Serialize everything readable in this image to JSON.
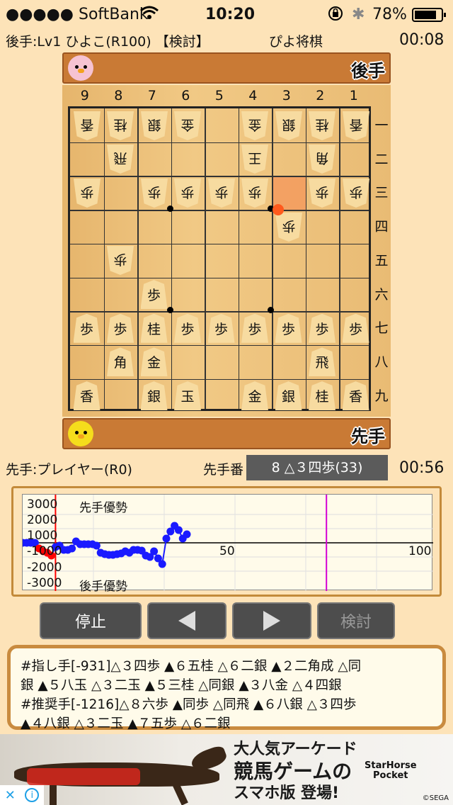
{
  "status_bar": {
    "carrier": "●●●●● SoftBank",
    "time": "10:20",
    "battery": "78%"
  },
  "header": {
    "gote_player": "後手:Lv1 ひよこ(R100) 【検討】",
    "app_title": "ぴよ将棋",
    "gote_time": "00:08"
  },
  "gote_hand": {
    "label": "後手"
  },
  "sente_hand": {
    "label": "先手"
  },
  "board": {
    "col_labels": [
      "9",
      "8",
      "7",
      "6",
      "5",
      "4",
      "3",
      "2",
      "1"
    ],
    "row_labels": [
      "一",
      "二",
      "三",
      "四",
      "五",
      "六",
      "七",
      "八",
      "九"
    ],
    "last_move_to": {
      "col": 3,
      "row": 4
    },
    "highlight_from": {
      "col": 3,
      "row": 3
    },
    "pieces": [
      {
        "col": 9,
        "row": 1,
        "p": "香",
        "o": "g"
      },
      {
        "col": 8,
        "row": 1,
        "p": "桂",
        "o": "g"
      },
      {
        "col": 7,
        "row": 1,
        "p": "銀",
        "o": "g"
      },
      {
        "col": 6,
        "row": 1,
        "p": "金",
        "o": "g"
      },
      {
        "col": 4,
        "row": 1,
        "p": "金",
        "o": "g"
      },
      {
        "col": 3,
        "row": 1,
        "p": "銀",
        "o": "g"
      },
      {
        "col": 2,
        "row": 1,
        "p": "桂",
        "o": "g"
      },
      {
        "col": 1,
        "row": 1,
        "p": "香",
        "o": "g"
      },
      {
        "col": 8,
        "row": 2,
        "p": "飛",
        "o": "g"
      },
      {
        "col": 4,
        "row": 2,
        "p": "王",
        "o": "g"
      },
      {
        "col": 2,
        "row": 2,
        "p": "角",
        "o": "g"
      },
      {
        "col": 9,
        "row": 3,
        "p": "歩",
        "o": "g"
      },
      {
        "col": 7,
        "row": 3,
        "p": "歩",
        "o": "g"
      },
      {
        "col": 6,
        "row": 3,
        "p": "歩",
        "o": "g"
      },
      {
        "col": 5,
        "row": 3,
        "p": "歩",
        "o": "g"
      },
      {
        "col": 4,
        "row": 3,
        "p": "歩",
        "o": "g"
      },
      {
        "col": 2,
        "row": 3,
        "p": "歩",
        "o": "g"
      },
      {
        "col": 1,
        "row": 3,
        "p": "歩",
        "o": "g"
      },
      {
        "col": 3,
        "row": 4,
        "p": "歩",
        "o": "g"
      },
      {
        "col": 8,
        "row": 5,
        "p": "歩",
        "o": "g"
      },
      {
        "col": 7,
        "row": 6,
        "p": "歩",
        "o": "s"
      },
      {
        "col": 9,
        "row": 7,
        "p": "歩",
        "o": "s"
      },
      {
        "col": 8,
        "row": 7,
        "p": "歩",
        "o": "s"
      },
      {
        "col": 7,
        "row": 7,
        "p": "桂",
        "o": "s"
      },
      {
        "col": 6,
        "row": 7,
        "p": "歩",
        "o": "s"
      },
      {
        "col": 5,
        "row": 7,
        "p": "歩",
        "o": "s"
      },
      {
        "col": 4,
        "row": 7,
        "p": "歩",
        "o": "s"
      },
      {
        "col": 3,
        "row": 7,
        "p": "歩",
        "o": "s"
      },
      {
        "col": 2,
        "row": 7,
        "p": "歩",
        "o": "s"
      },
      {
        "col": 1,
        "row": 7,
        "p": "歩",
        "o": "s"
      },
      {
        "col": 8,
        "row": 8,
        "p": "角",
        "o": "s"
      },
      {
        "col": 7,
        "row": 8,
        "p": "金",
        "o": "s"
      },
      {
        "col": 2,
        "row": 8,
        "p": "飛",
        "o": "s"
      },
      {
        "col": 9,
        "row": 9,
        "p": "香",
        "o": "s"
      },
      {
        "col": 7,
        "row": 9,
        "p": "銀",
        "o": "s"
      },
      {
        "col": 6,
        "row": 9,
        "p": "玉",
        "o": "s"
      },
      {
        "col": 4,
        "row": 9,
        "p": "金",
        "o": "s"
      },
      {
        "col": 3,
        "row": 9,
        "p": "銀",
        "o": "s"
      },
      {
        "col": 2,
        "row": 9,
        "p": "桂",
        "o": "s"
      },
      {
        "col": 1,
        "row": 9,
        "p": "香",
        "o": "s"
      }
    ]
  },
  "footer_info": {
    "sente_player": "先手:プレイヤー(R0)",
    "turn": "先手番",
    "current_move": "8 △３四歩(33)",
    "sente_time": "00:56"
  },
  "graph": {
    "labels": {
      "y3000": "3000",
      "y2000": "2000",
      "y1000": "1000",
      "yneg1000": "-1000",
      "yneg2000": "-2000",
      "yneg3000": "-3000",
      "sente_adv": "先手優勢",
      "gote_adv": "後手優勢",
      "mid_label": "50",
      "x_max": "100"
    },
    "chart_data": {
      "type": "line",
      "ylim": [
        -3000,
        3000
      ],
      "xlim": [
        0,
        100
      ],
      "current_move": 8,
      "marker_move": 74,
      "evaluations": [
        0,
        0,
        0,
        0,
        -400,
        -600,
        -700,
        -900,
        -300,
        -200,
        -500,
        -500,
        -400,
        100,
        -100,
        -100,
        -100,
        -100,
        -200,
        -700,
        -800,
        -850,
        -850,
        -800,
        -750,
        -600,
        -700,
        -500,
        -500,
        -550,
        -900,
        -1000,
        -600,
        -1100,
        -1500,
        300,
        800,
        1200,
        900,
        300,
        600
      ]
    }
  },
  "buttons": {
    "stop": "停止",
    "analyze": "検討"
  },
  "comment": {
    "line1": "#指し手[-931]△３四歩 ▲６五桂 △６二銀 ▲２二角成 △同",
    "line2": "銀 ▲５八玉 △３二玉 ▲５三桂 △同銀 ▲３八金 △４四銀",
    "line3": "#推奨手[-1216]△８六歩 ▲同歩 △同飛 ▲６八銀 △３四歩",
    "line4": "▲４八銀 △３二玉 ▲７五歩 △６二銀"
  },
  "ad": {
    "line1": "大人気アーケード",
    "line2": "競馬ゲームの",
    "line3": "スマホ版 登場!",
    "brand1": "StarHorse",
    "brand2": "Pocket",
    "copyright": "©SEGA"
  },
  "colors": {
    "graph_line": "#1a1aff",
    "graph_current": "#ff0000",
    "graph_marker": "#d400d4"
  }
}
